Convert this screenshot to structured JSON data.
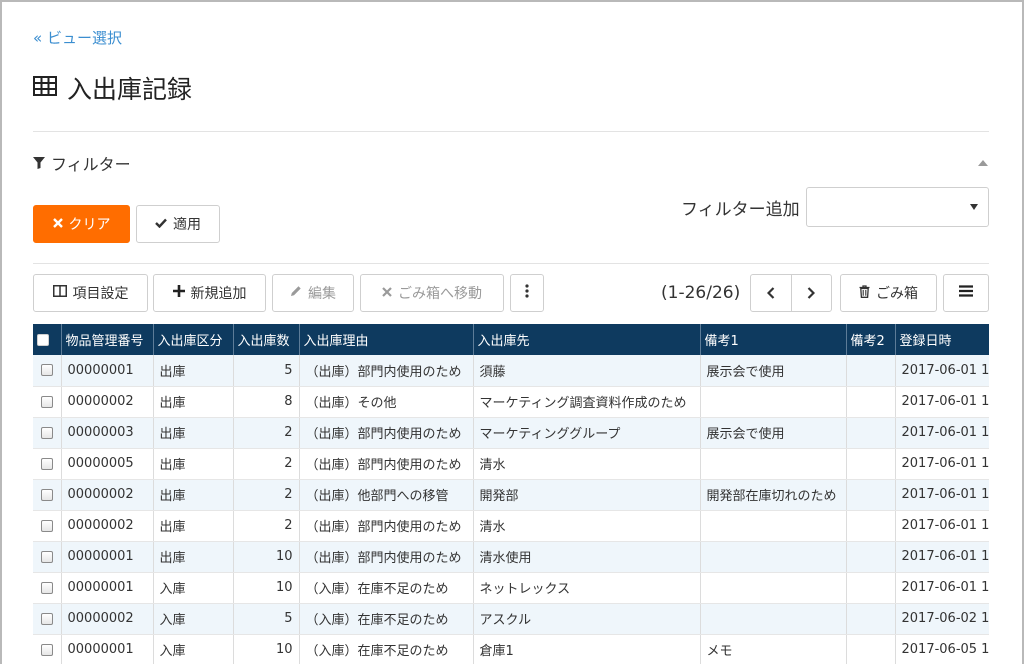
{
  "nav": {
    "back_link": "« ビュー選択"
  },
  "page": {
    "title": "入出庫記録"
  },
  "filter": {
    "header": "フィルター",
    "clear_label": "クリア",
    "apply_label": "適用",
    "add_label": "フィルター追加",
    "select_value": ""
  },
  "toolbar": {
    "columns_label": "項目設定",
    "new_label": "新規追加",
    "edit_label": "編集",
    "trash_move_label": "ごみ箱へ移動",
    "pager_info": "(1-26/26)",
    "trash_label": "ごみ箱"
  },
  "table": {
    "headers": [
      "物品管理番号",
      "入出庫区分",
      "入出庫数",
      "入出庫理由",
      "入出庫先",
      "備考1",
      "備考2",
      "登録日時"
    ],
    "rows": [
      [
        "00000001",
        "出庫",
        "5",
        "（出庫）部門内使用のため",
        "須藤",
        "展示会で使用",
        "",
        "2017-06-01 1"
      ],
      [
        "00000002",
        "出庫",
        "8",
        "（出庫）その他",
        "マーケティング調査資料作成のため",
        "",
        "",
        "2017-06-01 1"
      ],
      [
        "00000003",
        "出庫",
        "2",
        "（出庫）部門内使用のため",
        "マーケティンググループ",
        "展示会で使用",
        "",
        "2017-06-01 1"
      ],
      [
        "00000005",
        "出庫",
        "2",
        "（出庫）部門内使用のため",
        "清水",
        "",
        "",
        "2017-06-01 1"
      ],
      [
        "00000002",
        "出庫",
        "2",
        "（出庫）他部門への移管",
        "開発部",
        "開発部在庫切れのため",
        "",
        "2017-06-01 1"
      ],
      [
        "00000002",
        "出庫",
        "2",
        "（出庫）部門内使用のため",
        "清水",
        "",
        "",
        "2017-06-01 1"
      ],
      [
        "00000001",
        "出庫",
        "10",
        "（出庫）部門内使用のため",
        "清水使用",
        "",
        "",
        "2017-06-01 1"
      ],
      [
        "00000001",
        "入庫",
        "10",
        "（入庫）在庫不足のため",
        "ネットレックス",
        "",
        "",
        "2017-06-01 1"
      ],
      [
        "00000002",
        "入庫",
        "5",
        "（入庫）在庫不足のため",
        "アスクル",
        "",
        "",
        "2017-06-02 1"
      ],
      [
        "00000001",
        "入庫",
        "10",
        "（入庫）在庫不足のため",
        "倉庫1",
        "メモ",
        "",
        "2017-06-05 1"
      ]
    ]
  },
  "colors": {
    "accent": "#ff6d00",
    "link": "#3b8ed0",
    "header_bg": "#0e3a5f",
    "stripe": "#eff6fb"
  },
  "icons": {
    "title": "table-icon",
    "filter": "funnel-icon",
    "clear": "x-icon",
    "apply": "check-icon",
    "columns": "columns-icon",
    "new": "plus-icon",
    "edit": "pencil-icon",
    "trash_move": "x-icon",
    "more": "vertical-dots-icon",
    "prev": "chevron-left-icon",
    "next": "chevron-right-icon",
    "trash": "trash-icon",
    "menu": "hamburger-icon"
  }
}
